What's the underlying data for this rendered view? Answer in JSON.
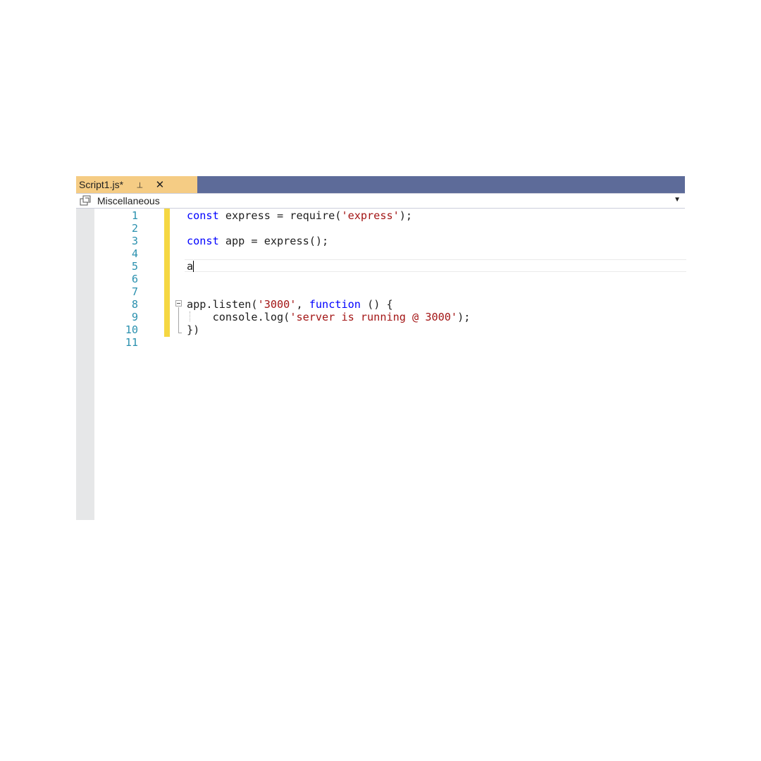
{
  "tab": {
    "title": "Script1.js*",
    "pin_icon": "pin-icon",
    "close_icon": "close-icon"
  },
  "navbar": {
    "icon": "miscellaneous-project-icon",
    "label": "Miscellaneous",
    "dropdown_icon": "chevron-down-icon"
  },
  "editor": {
    "line_numbers": [
      "1",
      "2",
      "3",
      "4",
      "5",
      "6",
      "7",
      "8",
      "9",
      "10",
      "11"
    ],
    "lines": [
      [
        {
          "t": "const",
          "c": "kw"
        },
        {
          "t": " express = require(",
          "c": ""
        },
        {
          "t": "'express'",
          "c": "str"
        },
        {
          "t": ");",
          "c": ""
        }
      ],
      [],
      [
        {
          "t": "const",
          "c": "kw"
        },
        {
          "t": " app = express();",
          "c": ""
        }
      ],
      [],
      [
        {
          "t": "a",
          "c": ""
        }
      ],
      [],
      [],
      [
        {
          "t": "app.listen(",
          "c": ""
        },
        {
          "t": "'3000'",
          "c": "str"
        },
        {
          "t": ", ",
          "c": ""
        },
        {
          "t": "function",
          "c": "kw"
        },
        {
          "t": " () {",
          "c": ""
        }
      ],
      [
        {
          "t": "    console.log(",
          "c": ""
        },
        {
          "t": "'server is running @ 3000'",
          "c": "str"
        },
        {
          "t": ");",
          "c": ""
        }
      ],
      [
        {
          "t": "})",
          "c": ""
        }
      ],
      []
    ],
    "caret_line": 5
  },
  "colors": {
    "tab_background": "#f5cc84",
    "tabstrip_background": "#5d6b99",
    "keyword": "#0000ff",
    "string": "#a31515",
    "line_number": "#2b91af",
    "change_bar": "#f5d742"
  }
}
